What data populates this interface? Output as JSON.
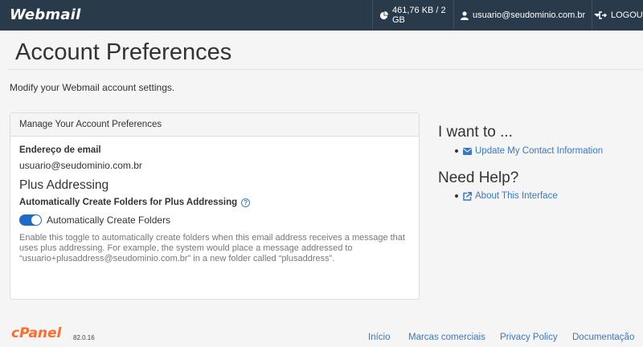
{
  "header": {
    "logo": "Webmail",
    "disk_usage": "461,76 KB / 2 GB",
    "user": "usuario@seudominio.com.br",
    "logout": "LOGOUT"
  },
  "page": {
    "title": "Account Preferences",
    "description": "Modify your Webmail account settings."
  },
  "panel": {
    "heading": "Manage Your Account Preferences",
    "email_label": "Endereço de email",
    "email_value": "usuario@seudominio.com.br",
    "section_title": "Plus Addressing",
    "toggle_label": "Automatically Create Folders for Plus Addressing",
    "help_icon": "?",
    "switch_label": "Automatically Create Folders",
    "switch_on": true,
    "help_text": "Enable this toggle to automatically create folders when this email address receives a message that uses plus addressing. For example, the system would place a message addressed to “usuario+plusaddress@seudominio.com.br” in a new folder called “plusaddress”."
  },
  "sidebar": {
    "want_heading": "I want to ...",
    "want_link": "Update My Contact Information",
    "help_heading": "Need Help?",
    "help_link": "About This Interface"
  },
  "footer": {
    "logo": "cPanel",
    "version": "82.0.16",
    "links": [
      "Início",
      "Marcas comerciais",
      "Privacy Policy",
      "Documentação"
    ]
  },
  "colors": {
    "topbar": "#293a4a",
    "link": "#3a78c3",
    "toggle": "#1f6bc8",
    "cpanel_orange": "#ff6c2c"
  },
  "icons": {
    "disk": "pie-chart-icon",
    "user": "user-icon",
    "logout": "sign-out-icon",
    "contact": "envelope-icon",
    "help": "external-link-icon"
  }
}
